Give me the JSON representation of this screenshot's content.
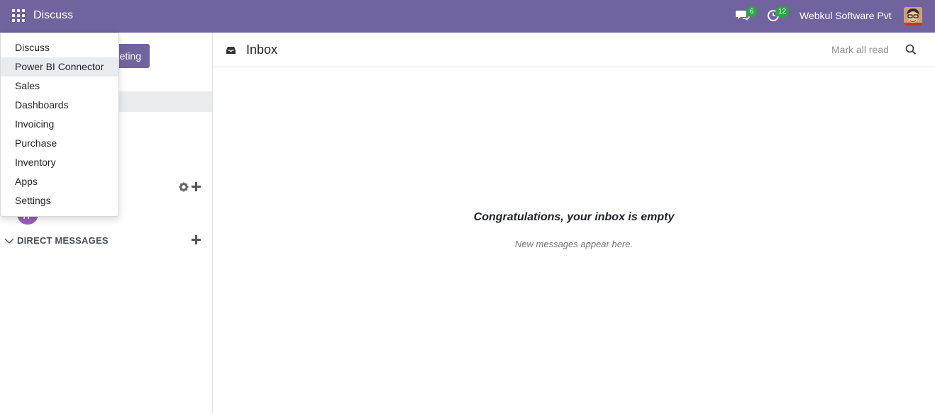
{
  "navbar": {
    "app_title": "Discuss",
    "chat_count": "6",
    "activity_count": "12",
    "company": "Webkul Software Pvt",
    "color": "#71639e"
  },
  "app_menu": {
    "items": [
      {
        "label": "Discuss"
      },
      {
        "label": "Power BI Connector",
        "highlighted": true
      },
      {
        "label": "Sales"
      },
      {
        "label": "Dashboards"
      },
      {
        "label": "Invoicing"
      },
      {
        "label": "Purchase"
      },
      {
        "label": "Inventory"
      },
      {
        "label": "Apps"
      },
      {
        "label": "Settings"
      }
    ]
  },
  "sidebar": {
    "meeting_button_visible": "eting",
    "direct_messages_label": "DIRECT MESSAGES"
  },
  "main": {
    "title": "Inbox",
    "mark_all_read": "Mark all read",
    "empty_title": "Congratulations, your inbox is empty",
    "empty_subtitle": "New messages appear here."
  },
  "icons": {
    "apps": "apps-grid-icon",
    "chat": "chat-icon",
    "activity": "clock-icon",
    "inbox": "inbox-icon",
    "search": "search-icon",
    "gear": "gear-icon",
    "plus": "plus-icon",
    "chevron": "chevron-down-icon"
  }
}
